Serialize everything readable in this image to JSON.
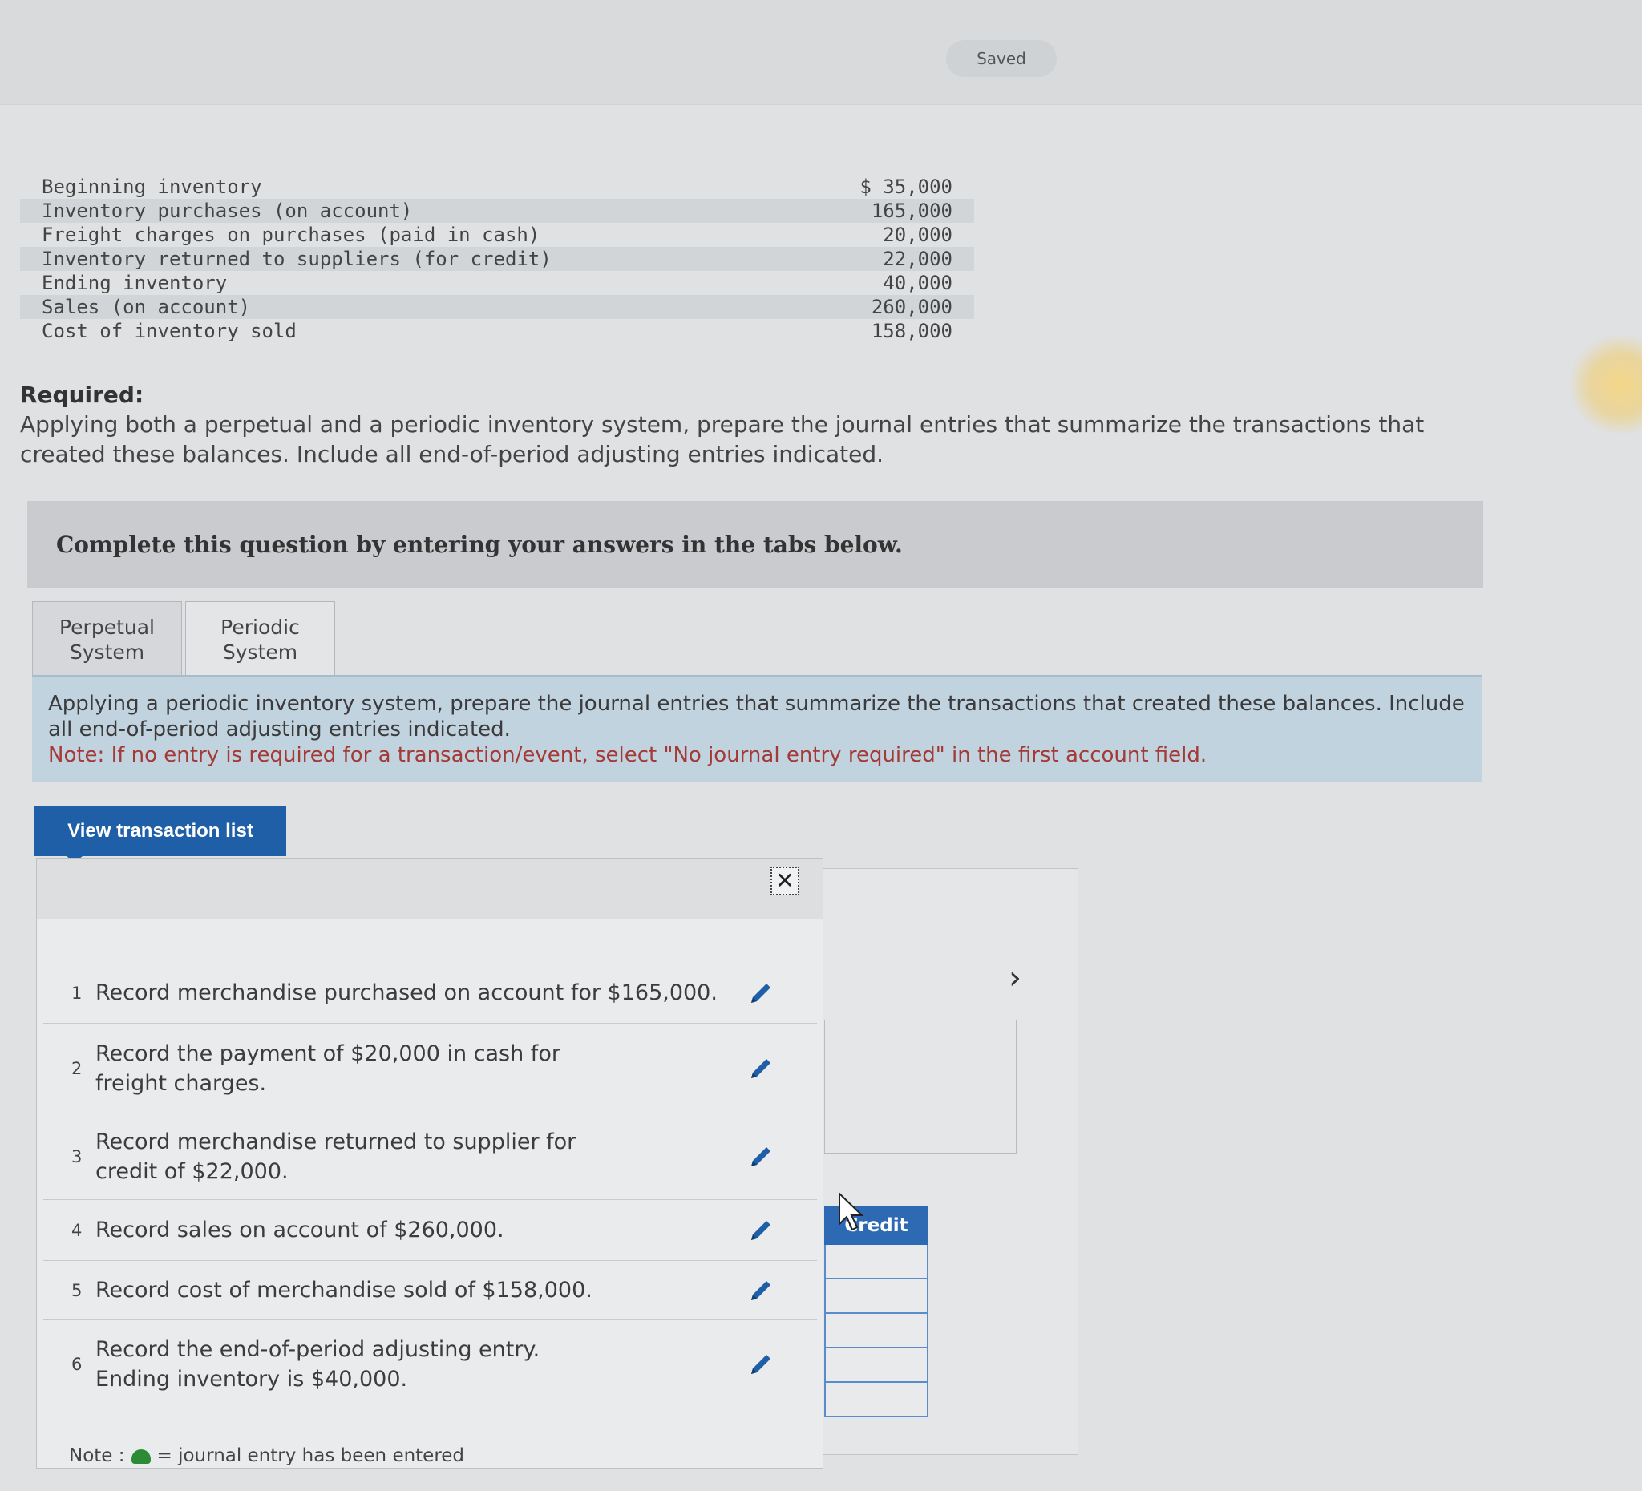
{
  "header": {
    "saved_label": "Saved"
  },
  "inventory_table": [
    {
      "label": "Beginning inventory",
      "amount": "$ 35,000"
    },
    {
      "label": "Inventory purchases (on account)",
      "amount": "165,000"
    },
    {
      "label": "Freight charges on purchases (paid in cash)",
      "amount": "20,000"
    },
    {
      "label": "Inventory returned to suppliers (for credit)",
      "amount": "22,000"
    },
    {
      "label": "Ending inventory",
      "amount": "40,000"
    },
    {
      "label": "Sales (on account)",
      "amount": "260,000"
    },
    {
      "label": "Cost of inventory sold",
      "amount": "158,000"
    }
  ],
  "required": {
    "title": "Required:",
    "text": "Applying both a perpetual and a periodic inventory system, prepare the journal entries that summarize the transactions that created these balances. Include all end-of-period adjusting entries indicated."
  },
  "complete_banner": "Complete this question by entering your answers in the tabs below.",
  "tabs": [
    {
      "line1": "Perpetual",
      "line2": "System"
    },
    {
      "line1": "Periodic",
      "line2": "System"
    }
  ],
  "instruction": {
    "text": "Applying a periodic inventory system, prepare the journal entries that summarize the transactions that created these balances. Include all end-of-period adjusting entries indicated.",
    "note": "Note: If no entry is required for a transaction/event, select \"No journal entry required\" in the first account field."
  },
  "view_transaction_button": "View transaction list",
  "transactions": [
    {
      "num": "1",
      "desc": "Record merchandise purchased on account for $165,000."
    },
    {
      "num": "2",
      "desc": "Record the payment of $20,000 in cash for freight charges."
    },
    {
      "num": "3",
      "desc": "Record merchandise returned to supplier for credit of $22,000."
    },
    {
      "num": "4",
      "desc": "Record sales on account of $260,000."
    },
    {
      "num": "5",
      "desc": "Record cost of merchandise sold of $158,000."
    },
    {
      "num": "6",
      "desc": "Record the end-of-period adjusting entry. Ending inventory is $40,000."
    }
  ],
  "note": {
    "prefix": "Note :",
    "suffix": "= journal entry has been entered"
  },
  "background_table": {
    "credit_header": "Credit"
  },
  "colors": {
    "accent_blue": "#1f5fa8",
    "note_red": "#a33a35",
    "entered_green": "#2e8b35"
  }
}
